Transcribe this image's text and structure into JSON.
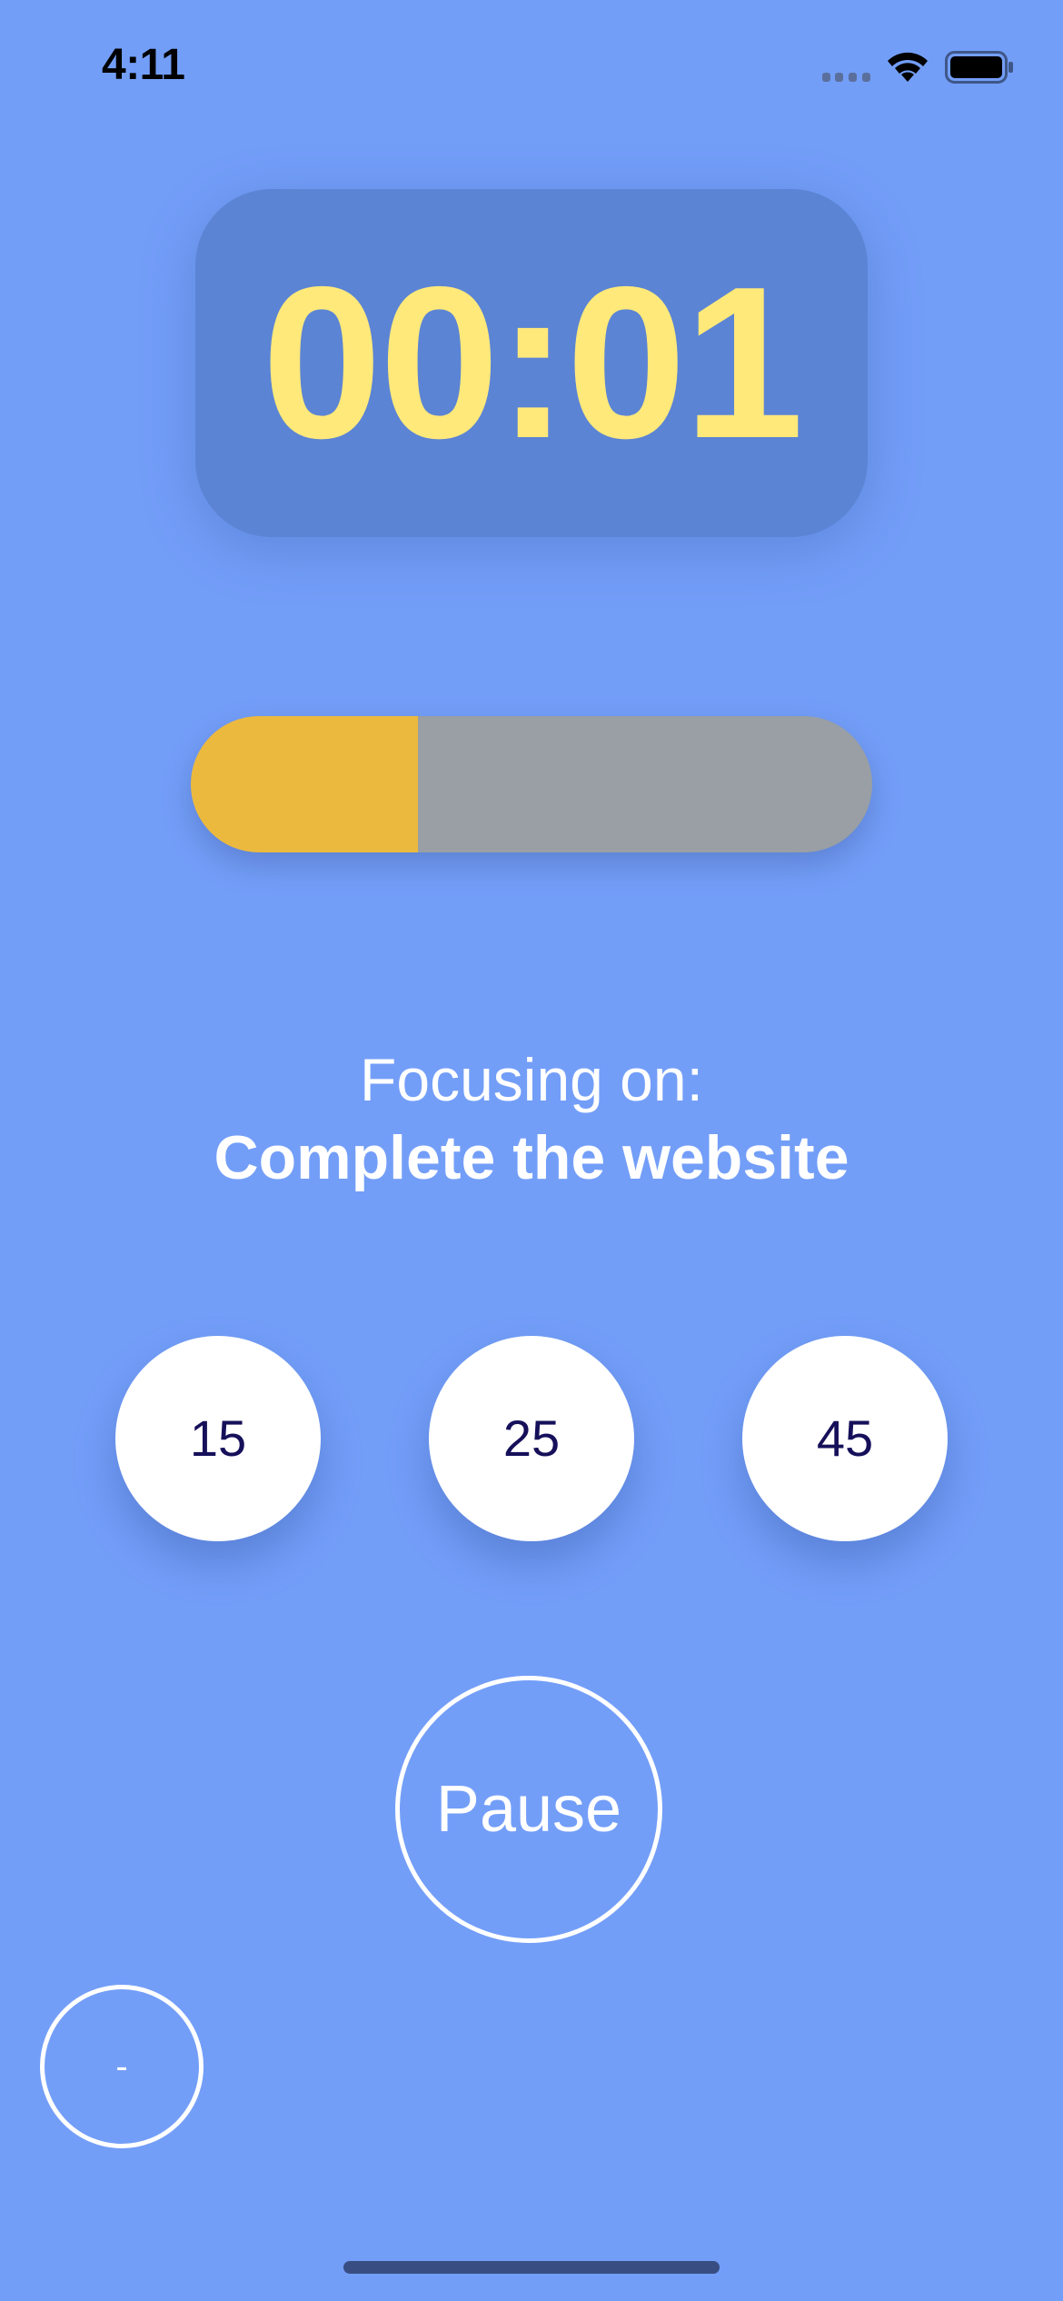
{
  "status_bar": {
    "time": "4:11",
    "icons": [
      "cellular-icon",
      "wifi-icon",
      "battery-icon"
    ]
  },
  "timer": {
    "display": "00:01",
    "color": "#ffe97a",
    "box_color": "#5c84d4"
  },
  "progress": {
    "fraction": 0.333,
    "fill_color": "#ecb93f",
    "track_color": "#999fa4"
  },
  "focus": {
    "label": "Focusing on:",
    "task": "Complete the website"
  },
  "presets": [
    {
      "label": "15"
    },
    {
      "label": "25"
    },
    {
      "label": "45"
    }
  ],
  "controls": {
    "pause_label": "Pause",
    "minus_label": "-"
  },
  "colors": {
    "background": "#739ef8",
    "preset_text": "#16105a"
  }
}
